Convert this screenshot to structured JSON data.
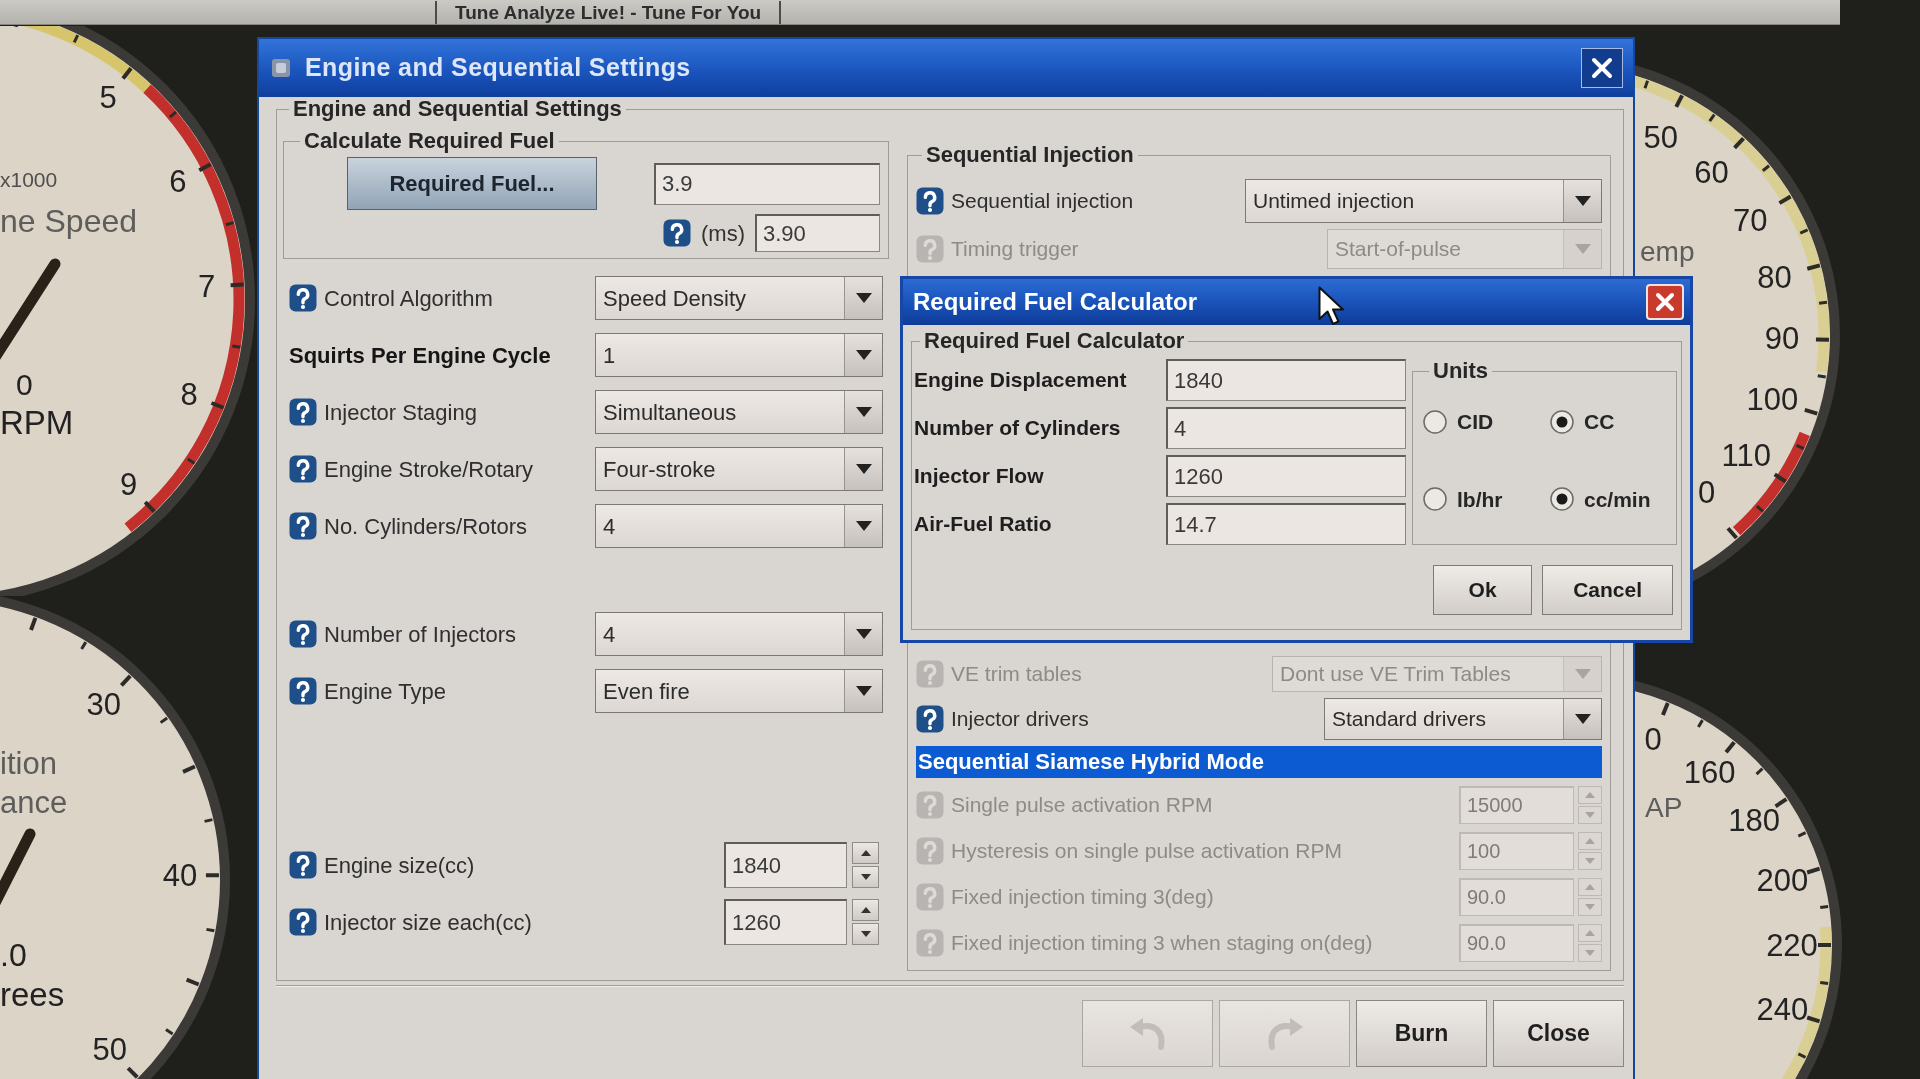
{
  "app_tabs": [
    {
      "label": "Tune Analyze Live! - Tune For You"
    }
  ],
  "gauges": [
    {
      "scale_labels": [
        "5",
        "6",
        "7",
        "8",
        "9"
      ],
      "captions": [
        "x1000",
        "ne Speed",
        "0",
        "RPM"
      ]
    },
    {
      "scale_labels": [
        "30",
        "40",
        "50"
      ],
      "captions": [
        "ition",
        "ance",
        ".0",
        "rees"
      ]
    },
    {
      "scale_labels": [
        "50",
        "60",
        "70",
        "80",
        "90",
        "100",
        "110"
      ],
      "captions": [
        "emp",
        "0"
      ]
    },
    {
      "scale_labels": [
        "0",
        "160",
        "180",
        "200",
        "220",
        "240"
      ],
      "captions": [
        "AP"
      ]
    }
  ],
  "settings_dialog": {
    "title": "Engine and Sequential Settings",
    "panel_title": "Engine and Sequential Settings",
    "required_fuel": {
      "title": "Calculate Required Fuel",
      "button": "Required Fuel...",
      "value": "3.9",
      "ms_label": "(ms)",
      "ms_value": "3.90"
    },
    "left_groups": [
      [
        {
          "kind": "select",
          "label": "Control Algorithm",
          "help": true,
          "bold": false,
          "value": "Speed Density"
        },
        {
          "kind": "select",
          "label": "Squirts Per Engine Cycle",
          "help": false,
          "bold": true,
          "value": "1"
        },
        {
          "kind": "select",
          "label": "Injector Staging",
          "help": true,
          "bold": false,
          "value": "Simultaneous"
        },
        {
          "kind": "select",
          "label": "Engine Stroke/Rotary",
          "help": true,
          "bold": false,
          "value": "Four-stroke"
        },
        {
          "kind": "select",
          "label": "No. Cylinders/Rotors",
          "help": true,
          "bold": false,
          "value": "4"
        }
      ],
      [
        {
          "kind": "select",
          "label": "Number of Injectors",
          "help": true,
          "bold": false,
          "value": "4"
        },
        {
          "kind": "select",
          "label": "Engine Type",
          "help": true,
          "bold": false,
          "value": "Even fire"
        }
      ],
      [
        {
          "kind": "spinner",
          "label": "Engine size(cc)",
          "help": true,
          "bold": false,
          "value": "1840"
        },
        {
          "kind": "spinner",
          "label": "Injector size each(cc)",
          "help": true,
          "bold": false,
          "value": "1260"
        }
      ]
    ],
    "sequential_injection": {
      "title": "Sequential Injection",
      "upper_rows": [
        {
          "kind": "select",
          "label": "Sequential injection",
          "help": true,
          "disabled": false,
          "value": "Untimed injection"
        },
        {
          "kind": "select",
          "label": "Timing trigger",
          "help": true,
          "disabled": true,
          "value": "Start-of-pulse"
        }
      ],
      "lower_rows": [
        {
          "kind": "select",
          "label": "VE trim tables",
          "help": true,
          "disabled": true,
          "value": "Dont use VE Trim Tables"
        },
        {
          "kind": "select",
          "label": "Injector drivers",
          "help": true,
          "disabled": false,
          "value": "Standard drivers"
        }
      ],
      "section_title": "Sequential Siamese Hybrid Mode",
      "spinner_rows": [
        {
          "kind": "spinner",
          "label": "Single pulse activation RPM",
          "help": true,
          "disabled": true,
          "value": "15000"
        },
        {
          "kind": "spinner",
          "label": "Hysteresis on single pulse activation RPM",
          "help": true,
          "disabled": true,
          "value": "100"
        },
        {
          "kind": "spinner",
          "label": "Fixed injection timing 3(deg)",
          "help": true,
          "disabled": true,
          "value": "90.0"
        },
        {
          "kind": "spinner",
          "label": "Fixed injection timing 3 when staging on(deg)",
          "help": true,
          "disabled": true,
          "value": "90.0"
        }
      ]
    },
    "buttons": [
      {
        "kind": "undo",
        "disabled": true
      },
      {
        "kind": "redo",
        "disabled": true
      },
      {
        "kind": "text",
        "label": "Burn",
        "disabled": false
      },
      {
        "kind": "text",
        "label": "Close",
        "disabled": false
      }
    ]
  },
  "calculator": {
    "title": "Required Fuel Calculator",
    "panel_title": "Required Fuel Calculator",
    "fields": [
      {
        "label": "Engine Displacement",
        "value": "1840"
      },
      {
        "label": "Number of Cylinders",
        "value": "4"
      },
      {
        "label": "Injector Flow",
        "value": "1260"
      },
      {
        "label": "Air-Fuel Ratio",
        "value": "14.7"
      }
    ],
    "units": {
      "title": "Units",
      "rows": [
        [
          {
            "label": "CID",
            "selected": false
          },
          {
            "label": "CC",
            "selected": true
          }
        ],
        [
          {
            "label": "lb/hr",
            "selected": false
          },
          {
            "label": "cc/min",
            "selected": true
          }
        ]
      ]
    },
    "buttons": [
      "Ok",
      "Cancel"
    ]
  }
}
